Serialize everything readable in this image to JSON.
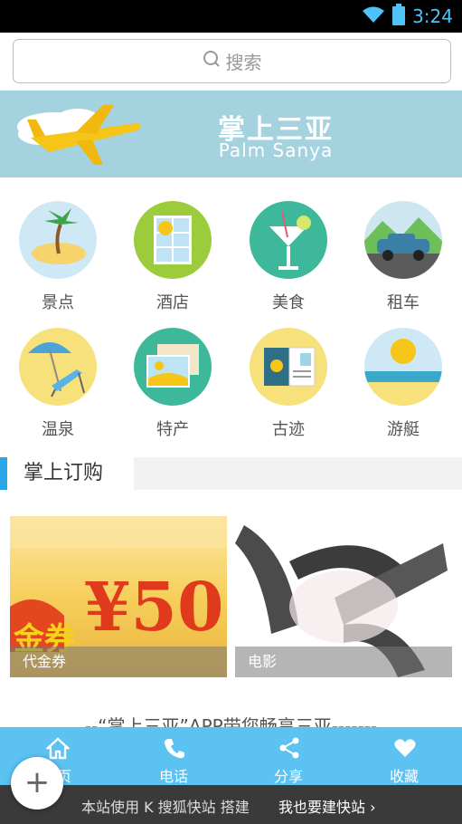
{
  "status_bar": {
    "time": "3:24",
    "time_color": "#4fc3f7"
  },
  "search": {
    "placeholder": "搜索"
  },
  "banner": {
    "title": "掌上三亚",
    "subtitle": "Palm Sanya",
    "bg": "#a4d3df"
  },
  "categories": [
    {
      "label": "景点",
      "icon": "island-palm-icon"
    },
    {
      "label": "酒店",
      "icon": "hotel-window-icon"
    },
    {
      "label": "美食",
      "icon": "cocktail-icon"
    },
    {
      "label": "租车",
      "icon": "car-icon"
    },
    {
      "label": "温泉",
      "icon": "beach-chair-icon"
    },
    {
      "label": "特产",
      "icon": "postcard-icon"
    },
    {
      "label": "古迹",
      "icon": "passport-icon"
    },
    {
      "label": "游艇",
      "icon": "sun-sea-icon"
    }
  ],
  "section": {
    "title": "掌上订购",
    "accent": "#2aa7e8"
  },
  "cards": [
    {
      "caption": "代金券",
      "image_text_1": "金券",
      "image_text_2": "¥50"
    },
    {
      "caption": "电影"
    }
  ],
  "tagline": "--“掌上三亚”APP带您畅享三亚-------",
  "bottom_nav": [
    {
      "label": "首页",
      "icon": "home-icon"
    },
    {
      "label": "电话",
      "icon": "phone-icon"
    },
    {
      "label": "分享",
      "icon": "share-icon"
    },
    {
      "label": "收藏",
      "icon": "heart-icon"
    }
  ],
  "footer": {
    "text": "本站使用 K 搜狐快站 搭建",
    "link": "我也要建快站 ›"
  },
  "fab": {
    "label": "+"
  }
}
